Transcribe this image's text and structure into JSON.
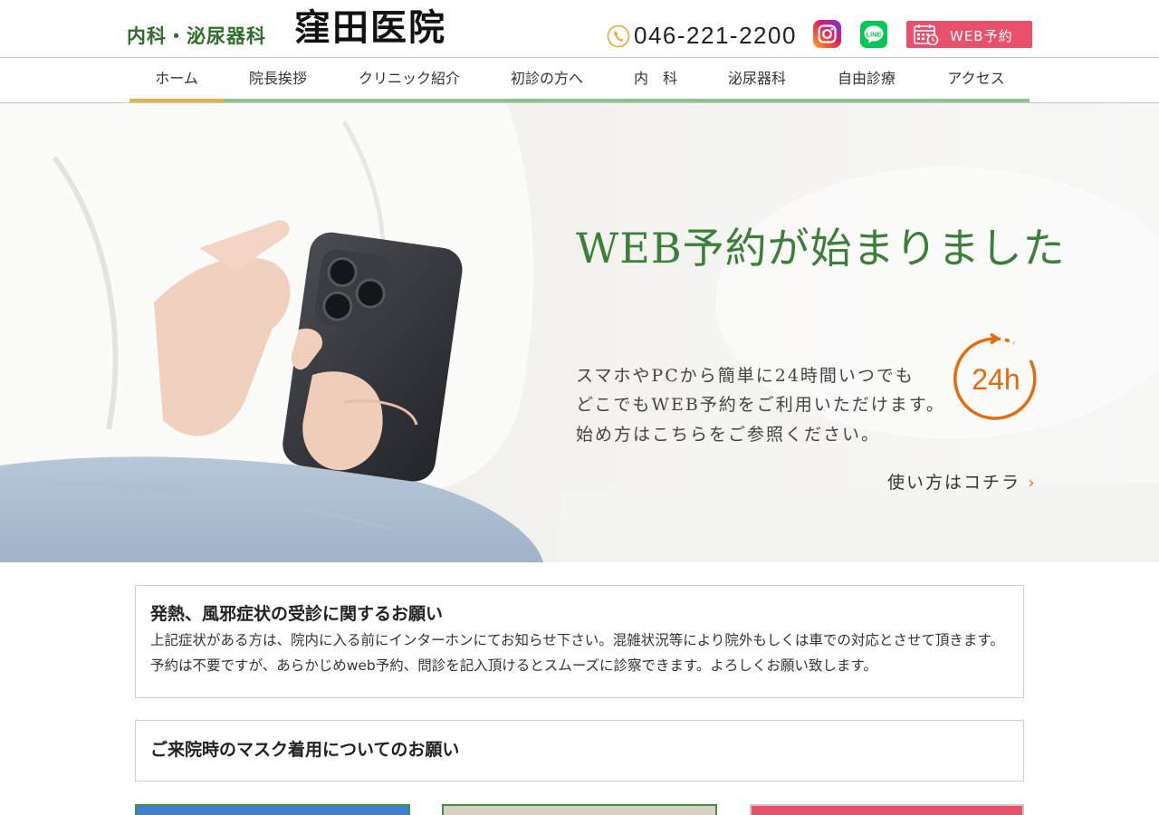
{
  "header": {
    "logo_sub": "内科・泌尿器科",
    "logo_main": "窪田医院",
    "phone": "046-221-2200",
    "instagram_icon": "instagram-icon",
    "line_icon": "line-icon",
    "web_reserve_label": "WEB予約",
    "colors": {
      "brand_green": "#2e6e2a",
      "reserve_pink": "#e9506c"
    }
  },
  "nav": {
    "items": [
      {
        "label": "ホーム",
        "active": true
      },
      {
        "label": "院長挨拶"
      },
      {
        "label": "クリニック紹介"
      },
      {
        "label": "初診の方へ"
      },
      {
        "label": "内　科"
      },
      {
        "label": "泌尿器科"
      },
      {
        "label": "自由診療"
      },
      {
        "label": "アクセス"
      }
    ],
    "colors": {
      "active_underline": "#e8b24a",
      "underline": "#8ac592"
    }
  },
  "hero": {
    "title": "WEB予約が始まりました",
    "lines": [
      "スマホやPCから簡単に24時間いつでも",
      "どこでもWEB予約をご利用いただけます。",
      "始め方はこちらをご参照ください。"
    ],
    "badge_text": "24h",
    "link_label": "使い方はコチラ",
    "link_arrow": "›",
    "colors": {
      "title_green": "#3b7f3b",
      "badge_orange": "#e86a10"
    }
  },
  "notices": [
    {
      "title": "発熱、風邪症状の受診に関するお願い",
      "body": "上記症状がある方は、院内に入る前にインターホンにてお知らせ下さい。混雑状況等により院外もしくは車での対応とさせて頂きます。予約は不要ですが、あらかじめweb予約、問診を記入頂けるとスムーズに診察できます。よろしくお願い致します。"
    },
    {
      "title": "ご来院時のマスク着用についてのお願い",
      "body": ""
    }
  ]
}
